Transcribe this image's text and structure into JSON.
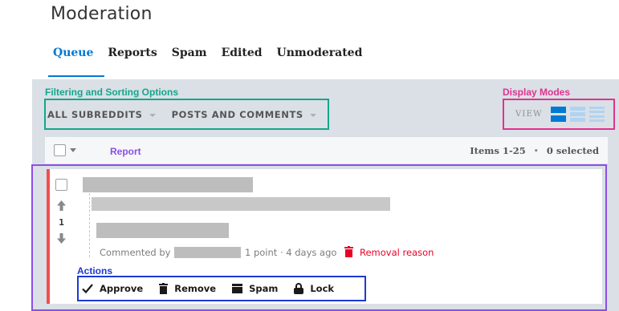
{
  "page": {
    "title": "Moderation"
  },
  "tabs": [
    {
      "label": "Queue",
      "active": true
    },
    {
      "label": "Reports"
    },
    {
      "label": "Spam"
    },
    {
      "label": "Edited"
    },
    {
      "label": "Unmoderated"
    }
  ],
  "annotations": {
    "filtering": "Filtering and Sorting Options",
    "display": "Display Modes",
    "report": "Report",
    "actions": "Actions"
  },
  "filters": {
    "subreddits": "ALL SUBREDDITS",
    "content": "POSTS AND COMMENTS"
  },
  "view": {
    "label": "VIEW",
    "modes": [
      "card-view-icon",
      "classic-view-icon",
      "compact-view-icon"
    ]
  },
  "list_header": {
    "items_range": "Items 1-25",
    "separator": "•",
    "selected": "0 selected"
  },
  "report": {
    "score": "1",
    "commented_by": "Commented by",
    "points_time": "1 point · 4 days ago",
    "removal_reason": "Removal reason"
  },
  "actions": [
    {
      "label": "Approve",
      "icon": "checkmark-icon"
    },
    {
      "label": "Remove",
      "icon": "trash-icon"
    },
    {
      "label": "Spam",
      "icon": "spam-icon"
    },
    {
      "label": "Lock",
      "icon": "lock-icon"
    }
  ],
  "colors": {
    "accent": "#0079d3",
    "filter_annotation": "#14a68c",
    "display_annotation": "#e0338f",
    "report_annotation": "#8b4fe6",
    "actions_annotation": "#1c3ad3",
    "removal_red": "#ea0027",
    "report_strip": "#f14e50"
  }
}
